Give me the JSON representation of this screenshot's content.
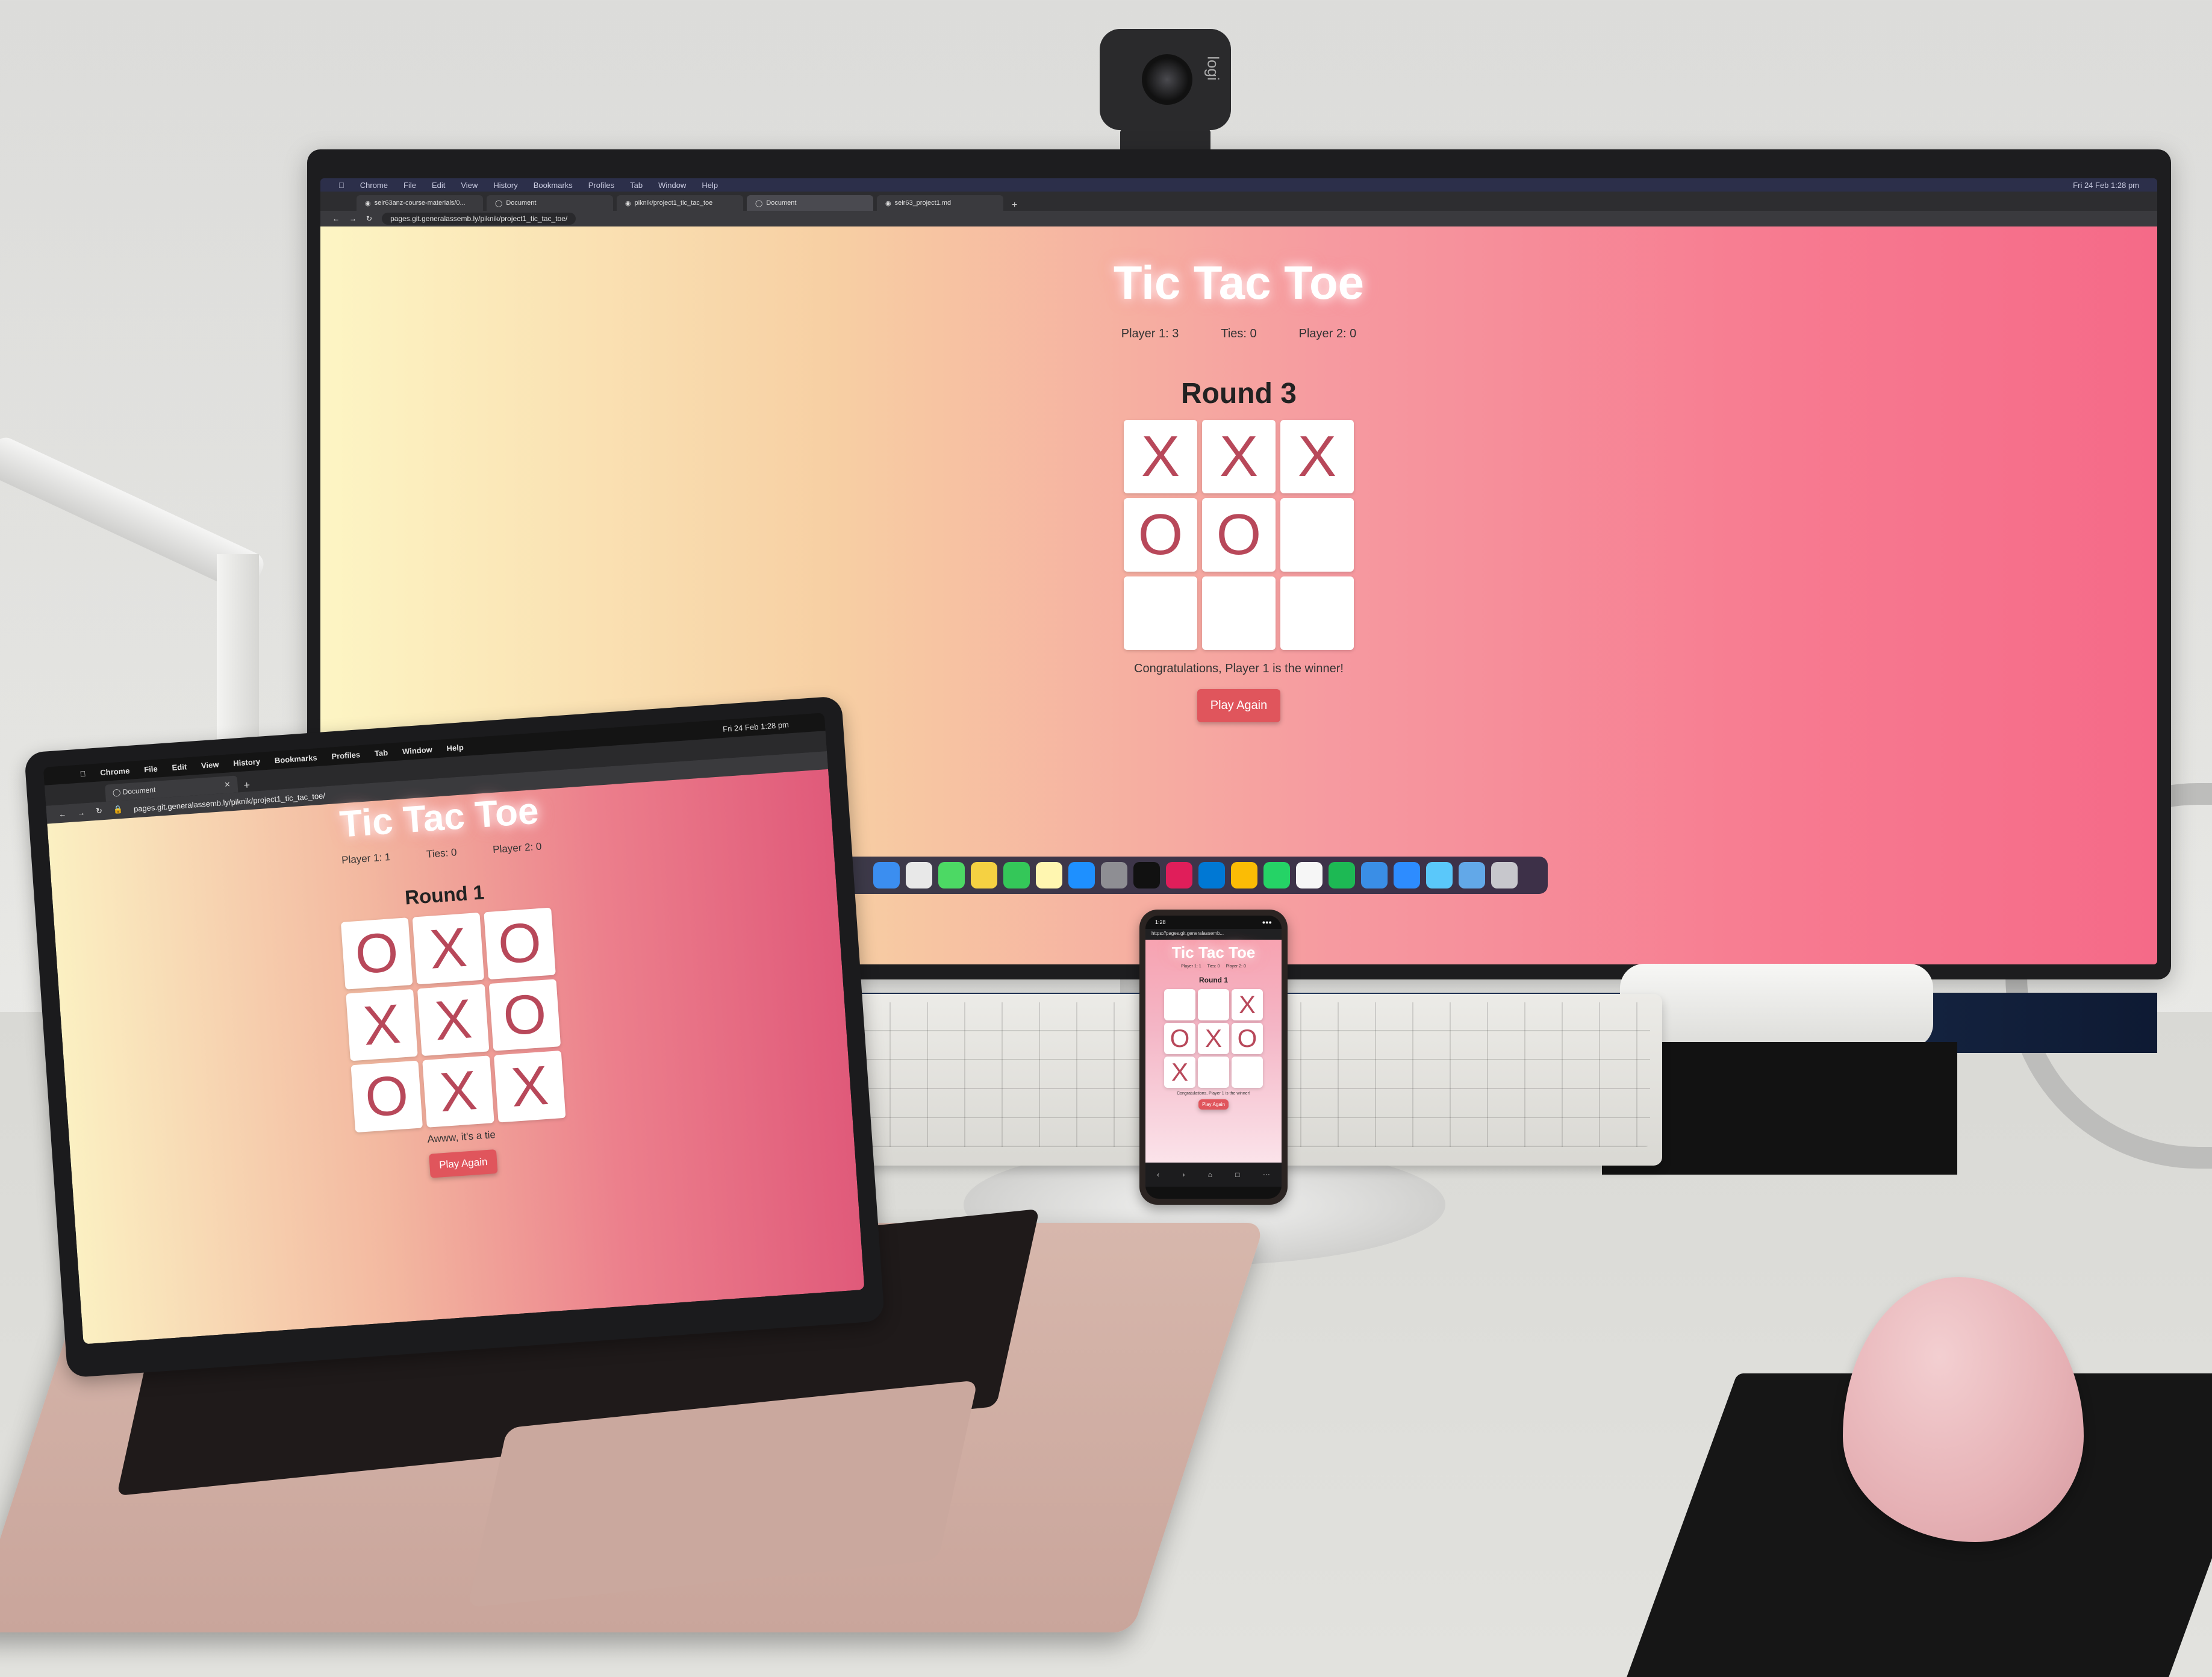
{
  "scene": {
    "webcam_brand": "logi"
  },
  "monitor": {
    "menubar": [
      "Chrome",
      "File",
      "Edit",
      "View",
      "History",
      "Bookmarks",
      "Profiles",
      "Tab",
      "Window",
      "Help"
    ],
    "clock": "Fri 24 Feb 1:28 pm",
    "tabs": [
      {
        "label": "seir63anz-course-materials/0..."
      },
      {
        "label": "Document"
      },
      {
        "label": "piknik/project1_tic_tac_toe"
      },
      {
        "label": "Document"
      },
      {
        "label": "seir63_project1.md"
      }
    ],
    "url": "pages.git.generalassemb.ly/piknik/project1_tic_tac_toe/",
    "game": {
      "title": "Tic Tac Toe",
      "score_p1": "Player 1: 3",
      "score_ties": "Ties: 0",
      "score_p2": "Player 2: 0",
      "round": "Round 3",
      "board": [
        "X",
        "X",
        "X",
        "O",
        "O",
        "",
        "",
        "",
        ""
      ],
      "message": "Congratulations, Player 1 is the winner!",
      "button": "Play Again"
    }
  },
  "laptop": {
    "menubar": [
      "Chrome",
      "File",
      "Edit",
      "View",
      "History",
      "Bookmarks",
      "Profiles",
      "Tab",
      "Window",
      "Help"
    ],
    "clock": "Fri 24 Feb 1:28 pm",
    "tab": "Document",
    "url": "pages.git.generalassemb.ly/piknik/project1_tic_tac_toe/",
    "game": {
      "title": "Tic Tac Toe",
      "score_p1": "Player 1: 1",
      "score_ties": "Ties: 0",
      "score_p2": "Player 2: 0",
      "round": "Round 1",
      "board": [
        "O",
        "X",
        "O",
        "X",
        "X",
        "O",
        "O",
        "X",
        "X"
      ],
      "message": "Awww, it's a tie",
      "button": "Play Again"
    }
  },
  "phone": {
    "time": "1:28",
    "url": "https://pages.git.generalassemb...",
    "game": {
      "title": "Tic Tac Toe",
      "score_p1": "Player 1: 1",
      "score_ties": "Ties: 0",
      "score_p2": "Player 2: 0",
      "round": "Round 1",
      "board": [
        "",
        "",
        "X",
        "O",
        "X",
        "O",
        "X",
        "",
        ""
      ],
      "message": "Congratulations, Player 1 is the winner!",
      "button": "Play Again"
    }
  },
  "colors": {
    "accent_button": "#e0555c",
    "mark": "#b8485a"
  }
}
